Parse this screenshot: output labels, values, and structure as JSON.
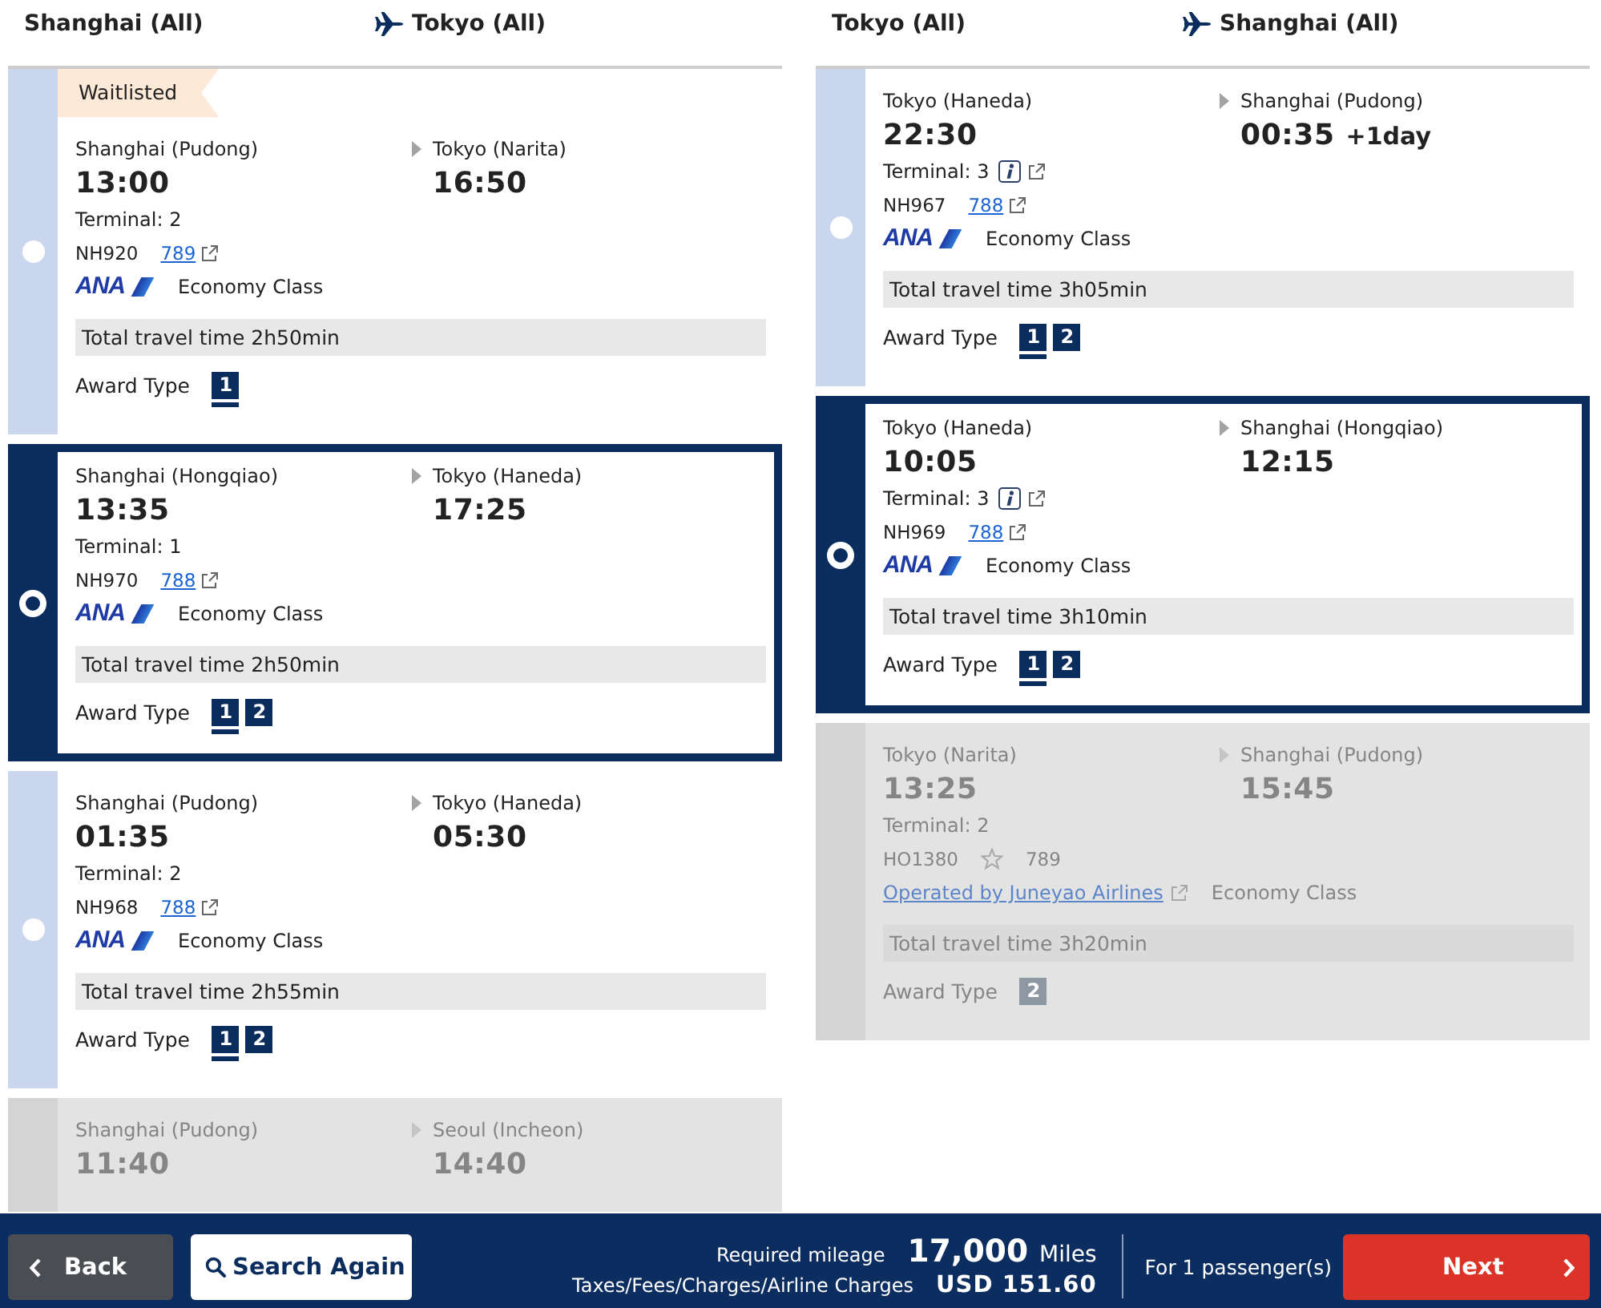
{
  "outbound": {
    "origin": "Shanghai (All)",
    "destination": "Tokyo (All)",
    "flights": [
      {
        "selected": false,
        "disabled": false,
        "tag": "Waitlisted",
        "departure": {
          "airport": "Shanghai (Pudong)",
          "time": "13:00",
          "terminal": "Terminal: 2",
          "terminal_info": false
        },
        "arrival": {
          "airport": "Tokyo (Narita)",
          "time": "16:50"
        },
        "flight_number": "NH920",
        "aircraft": {
          "text": "789",
          "link": true
        },
        "carrier": {
          "kind": "logo",
          "text": "ANA"
        },
        "cabin": "Economy Class",
        "total_time": "Total travel time 2h50min",
        "award_label": "Award Type",
        "award_types": [
          {
            "label": "1",
            "selected": true
          }
        ]
      },
      {
        "selected": true,
        "disabled": false,
        "departure": {
          "airport": "Shanghai (Hongqiao)",
          "time": "13:35",
          "terminal": "Terminal: 1",
          "terminal_info": false
        },
        "arrival": {
          "airport": "Tokyo (Haneda)",
          "time": "17:25"
        },
        "flight_number": "NH970",
        "aircraft": {
          "text": "788",
          "link": true
        },
        "carrier": {
          "kind": "logo",
          "text": "ANA"
        },
        "cabin": "Economy Class",
        "total_time": "Total travel time 2h50min",
        "award_label": "Award Type",
        "award_types": [
          {
            "label": "1",
            "selected": true
          },
          {
            "label": "2",
            "selected": false
          }
        ]
      },
      {
        "selected": false,
        "disabled": false,
        "departure": {
          "airport": "Shanghai (Pudong)",
          "time": "01:35",
          "terminal": "Terminal: 2",
          "terminal_info": false
        },
        "arrival": {
          "airport": "Tokyo (Haneda)",
          "time": "05:30"
        },
        "flight_number": "NH968",
        "aircraft": {
          "text": "788",
          "link": true
        },
        "carrier": {
          "kind": "logo",
          "text": "ANA"
        },
        "cabin": "Economy Class",
        "total_time": "Total travel time 2h55min",
        "award_label": "Award Type",
        "award_types": [
          {
            "label": "1",
            "selected": true
          },
          {
            "label": "2",
            "selected": false
          }
        ]
      },
      {
        "selected": false,
        "disabled": true,
        "departure": {
          "airport": "Shanghai (Pudong)",
          "time": "11:40"
        },
        "arrival": {
          "airport": "Seoul (Incheon)",
          "time": "14:40"
        }
      }
    ]
  },
  "inbound": {
    "origin": "Tokyo (All)",
    "destination": "Shanghai (All)",
    "flights": [
      {
        "selected": false,
        "disabled": false,
        "departure": {
          "airport": "Tokyo (Haneda)",
          "time": "22:30",
          "terminal": "Terminal: 3",
          "terminal_info": true
        },
        "arrival": {
          "airport": "Shanghai (Pudong)",
          "time": "00:35",
          "day_offset": "+1day"
        },
        "flight_number": "NH967",
        "aircraft": {
          "text": "788",
          "link": true
        },
        "carrier": {
          "kind": "logo",
          "text": "ANA"
        },
        "cabin": "Economy Class",
        "total_time": "Total travel time 3h05min",
        "award_label": "Award Type",
        "award_types": [
          {
            "label": "1",
            "selected": true
          },
          {
            "label": "2",
            "selected": false
          }
        ]
      },
      {
        "selected": true,
        "disabled": false,
        "departure": {
          "airport": "Tokyo (Haneda)",
          "time": "10:05",
          "terminal": "Terminal: 3",
          "terminal_info": true
        },
        "arrival": {
          "airport": "Shanghai (Hongqiao)",
          "time": "12:15"
        },
        "flight_number": "NH969",
        "aircraft": {
          "text": "788",
          "link": true
        },
        "carrier": {
          "kind": "logo",
          "text": "ANA"
        },
        "cabin": "Economy Class",
        "total_time": "Total travel time 3h10min",
        "award_label": "Award Type",
        "award_types": [
          {
            "label": "1",
            "selected": true
          },
          {
            "label": "2",
            "selected": false
          }
        ]
      },
      {
        "selected": false,
        "disabled": true,
        "departure": {
          "airport": "Tokyo (Narita)",
          "time": "13:25",
          "terminal": "Terminal: 2",
          "terminal_info": false
        },
        "arrival": {
          "airport": "Shanghai (Pudong)",
          "time": "15:45"
        },
        "flight_number": "HO1380",
        "aircraft": {
          "text": "789",
          "link": false
        },
        "carrier": {
          "kind": "operated",
          "text": "Operated by Juneyao Airlines"
        },
        "cabin": "Economy Class",
        "total_time": "Total travel time 3h20min",
        "award_label": "Award Type",
        "award_types": [
          {
            "label": "2",
            "selected": false
          }
        ]
      }
    ]
  },
  "footer": {
    "back": "Back",
    "search_again": "Search Again",
    "mileage": {
      "label": "Required mileage",
      "value": "17,000",
      "unit": "Miles"
    },
    "taxes": {
      "label": "Taxes/Fees/Charges/Airline Charges",
      "value": "USD 151.60"
    },
    "passengers": "For 1 passenger(s)",
    "next": "Next"
  }
}
